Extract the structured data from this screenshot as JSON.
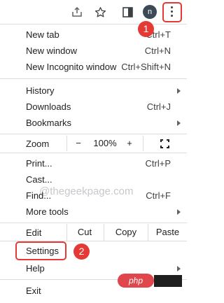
{
  "toolbar": {
    "icons": [
      "share-icon",
      "star-icon",
      "side-panel-icon",
      "more-menu-icon"
    ],
    "profile_initial": "n"
  },
  "menu": {
    "new_tab": {
      "label": "New tab",
      "shortcut": "Ctrl+T"
    },
    "new_window": {
      "label": "New window",
      "shortcut": "Ctrl+N"
    },
    "new_incognito": {
      "label": "New Incognito window",
      "shortcut": "Ctrl+Shift+N"
    },
    "history": {
      "label": "History"
    },
    "downloads": {
      "label": "Downloads",
      "shortcut": "Ctrl+J"
    },
    "bookmarks": {
      "label": "Bookmarks"
    },
    "zoom": {
      "label": "Zoom",
      "minus": "−",
      "level": "100%",
      "plus": "+"
    },
    "print": {
      "label": "Print...",
      "shortcut": "Ctrl+P"
    },
    "cast": {
      "label": "Cast..."
    },
    "find": {
      "label": "Find...",
      "shortcut": "Ctrl+F"
    },
    "more_tools": {
      "label": "More tools"
    },
    "edit": {
      "label": "Edit",
      "cut": "Cut",
      "copy": "Copy",
      "paste": "Paste"
    },
    "settings": {
      "label": "Settings"
    },
    "help": {
      "label": "Help"
    },
    "exit": {
      "label": "Exit"
    }
  },
  "annotations": {
    "step1": "1",
    "step2": "2",
    "watermark": "@thegeekpage.com",
    "php_badge": "php"
  },
  "colors": {
    "highlight": "#e53935",
    "separator": "#dadce0",
    "avatar": "#3c4a57"
  }
}
